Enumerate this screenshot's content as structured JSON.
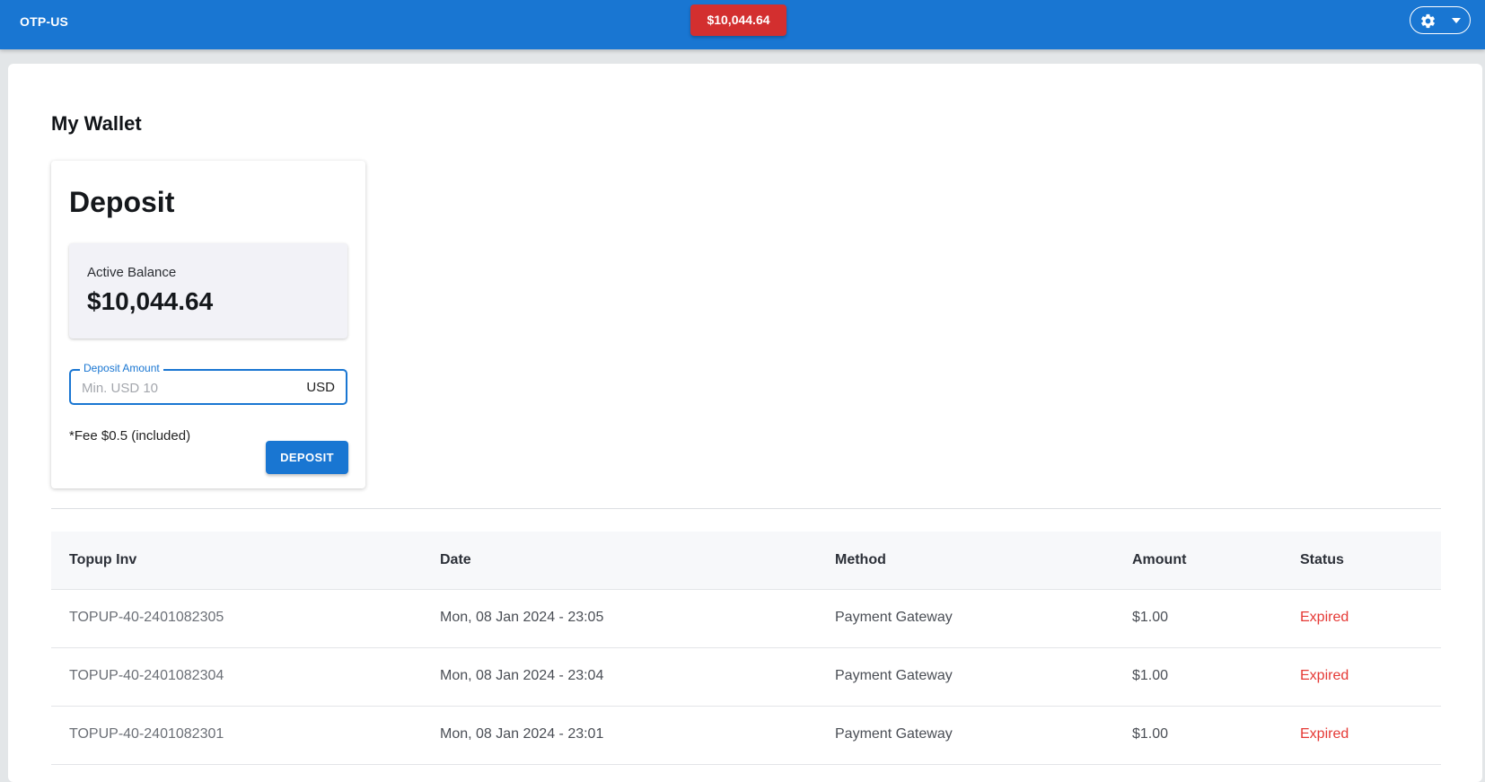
{
  "header": {
    "brand": "OTP-US",
    "balance_badge": "$10,044.64",
    "settings_icon": "gear-icon",
    "menu_icon": "caret-down-icon"
  },
  "page": {
    "title": "My Wallet"
  },
  "deposit": {
    "title": "Deposit",
    "active_balance_label": "Active Balance",
    "active_balance_value": "$10,044.64",
    "amount_field_label": "Deposit Amount",
    "amount_placeholder": "Min. USD 10",
    "amount_value": "",
    "amount_unit": "USD",
    "fee_note": "*Fee $0.5 (included)",
    "button_label": "DEPOSIT"
  },
  "table": {
    "columns": [
      "Topup Inv",
      "Date",
      "Method",
      "Amount",
      "Status"
    ],
    "rows": [
      {
        "invoice": "TOPUP-40-2401082305",
        "date": "Mon, 08 Jan 2024 - 23:05",
        "method": "Payment Gateway",
        "amount": "$1.00",
        "status": "Expired"
      },
      {
        "invoice": "TOPUP-40-2401082304",
        "date": "Mon, 08 Jan 2024 - 23:04",
        "method": "Payment Gateway",
        "amount": "$1.00",
        "status": "Expired"
      },
      {
        "invoice": "TOPUP-40-2401082301",
        "date": "Mon, 08 Jan 2024 - 23:01",
        "method": "Payment Gateway",
        "amount": "$1.00",
        "status": "Expired"
      }
    ]
  },
  "colors": {
    "primary": "#1976d2",
    "danger": "#d32f2f",
    "expired_text": "#e53935"
  }
}
